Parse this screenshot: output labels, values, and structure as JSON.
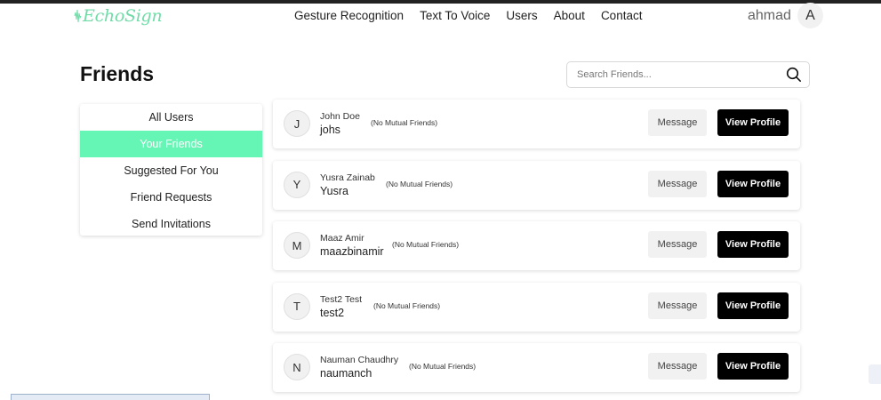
{
  "brand": {
    "name": "EchoSign",
    "color": "#6fdca8"
  },
  "nav": [
    {
      "label": "Gesture Recognition"
    },
    {
      "label": "Text To Voice"
    },
    {
      "label": "Users"
    },
    {
      "label": "About"
    },
    {
      "label": "Contact"
    }
  ],
  "user": {
    "name": "ahmad",
    "initial": "A"
  },
  "page": {
    "title": "Friends"
  },
  "search": {
    "placeholder": "Search Friends..."
  },
  "sidebar": {
    "active_color": "#65f5b5",
    "items": [
      {
        "label": "All Users",
        "active": false
      },
      {
        "label": "Your Friends",
        "active": true
      },
      {
        "label": "Suggested For You",
        "active": false
      },
      {
        "label": "Friend Requests",
        "active": false
      },
      {
        "label": "Send Invitations",
        "active": false
      }
    ]
  },
  "friends": [
    {
      "initial": "J",
      "full_name": "John Doe",
      "username": "johs",
      "mutual": "(No Mutual Friends)",
      "message_label": "Message",
      "view_label": "View Profile"
    },
    {
      "initial": "Y",
      "full_name": "Yusra Zainab",
      "username": "Yusra",
      "mutual": "(No Mutual Friends)",
      "message_label": "Message",
      "view_label": "View Profile"
    },
    {
      "initial": "M",
      "full_name": "Maaz Amir",
      "username": "maazbinamir",
      "mutual": "(No Mutual Friends)",
      "message_label": "Message",
      "view_label": "View Profile"
    },
    {
      "initial": "T",
      "full_name": "Test2 Test",
      "username": "test2",
      "mutual": "(No Mutual Friends)",
      "message_label": "Message",
      "view_label": "View Profile"
    },
    {
      "initial": "N",
      "full_name": "Nauman Chaudhry",
      "username": "naumanch",
      "mutual": "(No Mutual Friends)",
      "message_label": "Message",
      "view_label": "View Profile"
    }
  ]
}
